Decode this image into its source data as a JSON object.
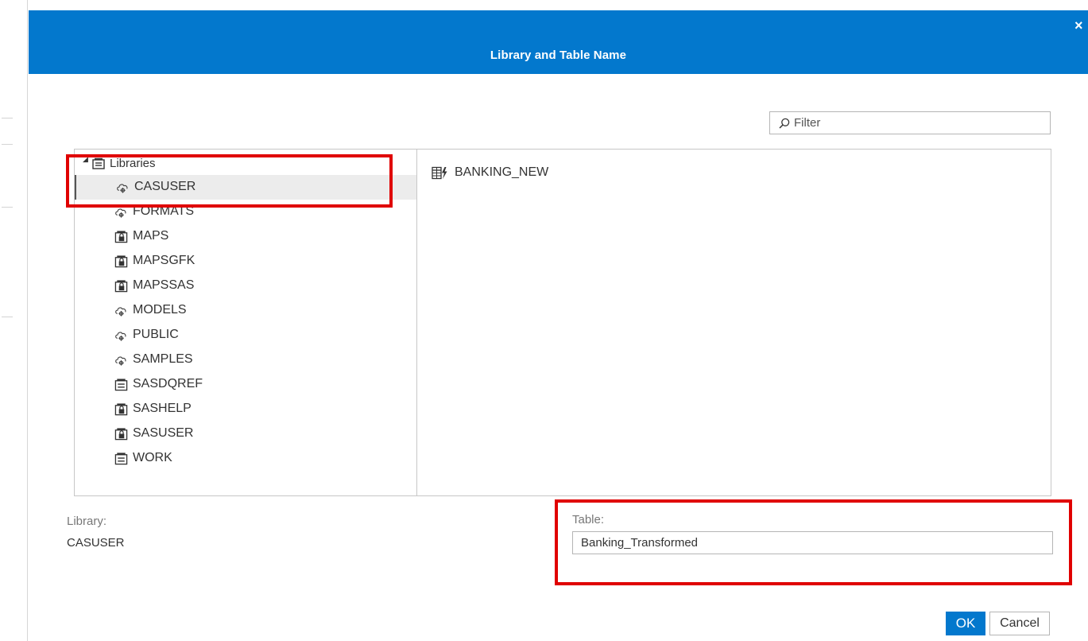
{
  "dialog": {
    "title": "Library and Table Name",
    "close_label": "×"
  },
  "filter": {
    "placeholder": "Filter"
  },
  "tree": {
    "root_label": "Libraries",
    "items": [
      {
        "label": "CASUSER",
        "icon": "cloud-library-icon",
        "selected": true
      },
      {
        "label": "FORMATS",
        "icon": "cloud-library-icon"
      },
      {
        "label": "MAPS",
        "icon": "locked-library-icon"
      },
      {
        "label": "MAPSGFK",
        "icon": "locked-library-icon"
      },
      {
        "label": "MAPSSAS",
        "icon": "locked-library-icon"
      },
      {
        "label": "MODELS",
        "icon": "cloud-library-icon"
      },
      {
        "label": "PUBLIC",
        "icon": "cloud-library-icon"
      },
      {
        "label": "SAMPLES",
        "icon": "cloud-library-icon"
      },
      {
        "label": "SASDQREF",
        "icon": "library-icon"
      },
      {
        "label": "SASHELP",
        "icon": "locked-library-icon"
      },
      {
        "label": "SASUSER",
        "icon": "locked-library-icon"
      },
      {
        "label": "WORK",
        "icon": "library-icon"
      }
    ]
  },
  "tables": {
    "items": [
      {
        "label": "BANKING_NEW",
        "icon": "cas-table-icon"
      }
    ]
  },
  "library": {
    "label": "Library:",
    "value": "CASUSER"
  },
  "table": {
    "label": "Table:",
    "value": "Banking_Transformed"
  },
  "buttons": {
    "ok": "OK",
    "cancel": "Cancel"
  },
  "colors": {
    "header": "#0378cd",
    "highlight": "#e00000",
    "selected_row": "#ececec"
  }
}
